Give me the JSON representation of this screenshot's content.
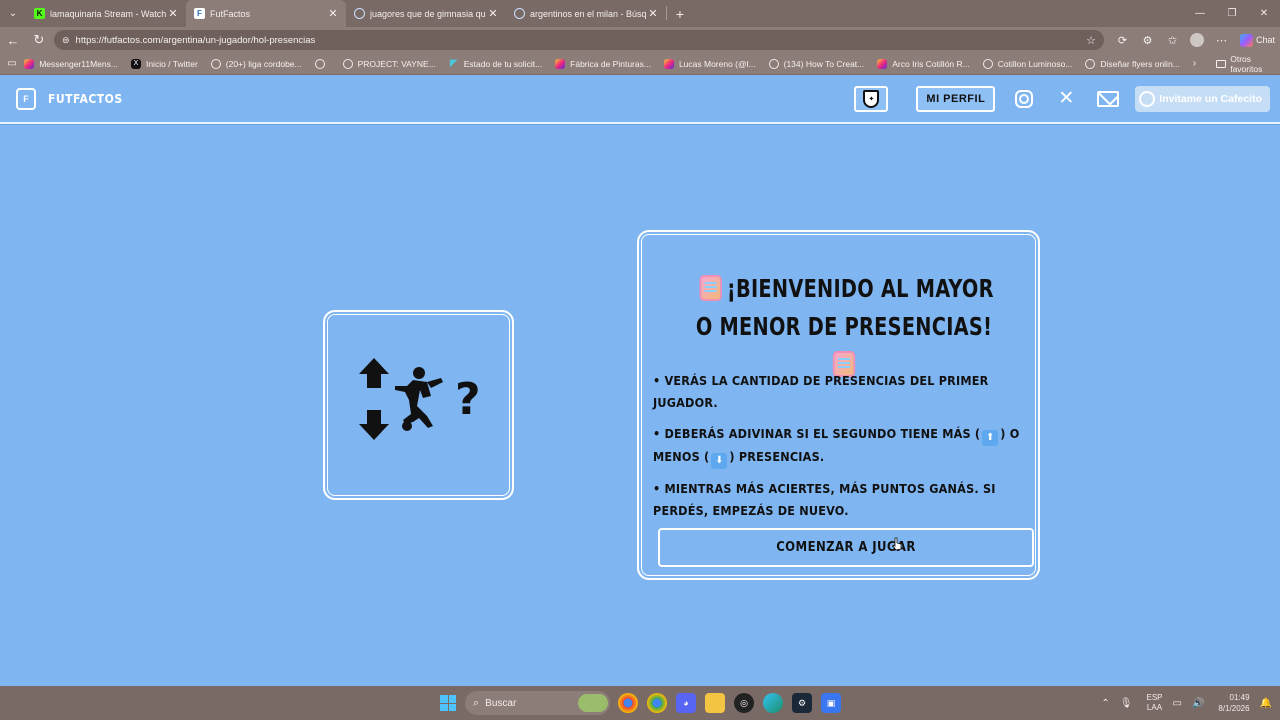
{
  "browser": {
    "tabs": [
      {
        "title": "lamaquinaria Stream - Watch Live",
        "active": false,
        "favicon": "K"
      },
      {
        "title": "FutFactos",
        "active": true,
        "favicon": "F"
      },
      {
        "title": "juagores que de gimnasia que jug",
        "active": false,
        "favicon": ""
      },
      {
        "title": "argentinos en el milan - Búsqueda",
        "active": false,
        "favicon": ""
      }
    ],
    "url": "https://futfactos.com/argentina/un-jugador/hol-presencias",
    "chat_label": "Chat",
    "bookmarks": [
      {
        "label": "Messenger11Mens...",
        "icon": "instagram-icon"
      },
      {
        "label": "Inicio / Twitter",
        "icon": "x-icon"
      },
      {
        "label": "(20+) liga cordobe...",
        "icon": "globe-icon"
      },
      {
        "label": "",
        "icon": "globe-icon"
      },
      {
        "label": "PROJECT: VAYNE...",
        "icon": "globe-icon"
      },
      {
        "label": "Estado de tu solicit...",
        "icon": "triangle-icon"
      },
      {
        "label": "Fábrica de Pinturas...",
        "icon": "instagram-icon"
      },
      {
        "label": "Lucas Moreno (@l...",
        "icon": "instagram-icon"
      },
      {
        "label": "(134) How To Creat...",
        "icon": "globe-icon"
      },
      {
        "label": "Arco Iris Cotillón R...",
        "icon": "instagram-icon"
      },
      {
        "label": "Cotillon Luminoso...",
        "icon": "globe-icon"
      },
      {
        "label": "Diseñar flyers onlin...",
        "icon": "globe-icon"
      }
    ],
    "other_favorites": "Otros favoritos"
  },
  "header": {
    "brand_name": "FUTFACTOS",
    "profile_label": "MI PERFIL",
    "cafecito_label": "Invitame un Cafecito"
  },
  "game": {
    "title": "¡BIENVENIDO AL MAYOR O MENOR DE PRESENCIAS!",
    "rule_1": "• VERÁS LA CANTIDAD DE PRESENCIAS DEL PRIMER JUGADOR.",
    "rule_2_a": "• DEBERÁS ADIVINAR SI EL SEGUNDO TIENE MÁS (",
    "rule_2_b": ") O MENOS (",
    "rule_2_c": ") PRESENCIAS.",
    "rule_3": "• MIENTRAS MÁS ACIERTES, MÁS PUNTOS GANÁS. SI PERDÉS, EMPEZÁS DE NUEVO.",
    "question_mark": "?",
    "start_button": "COMENZAR A JUGAR"
  },
  "taskbar": {
    "search_placeholder": "Buscar",
    "lang_top": "ESP",
    "lang_bottom": "LAA",
    "time": "01:49",
    "date": "8/1/2026"
  },
  "colors": {
    "page_bg": "#7fb6f2",
    "browser_chrome": "#8d7d78",
    "card_border": "#ffffff"
  }
}
